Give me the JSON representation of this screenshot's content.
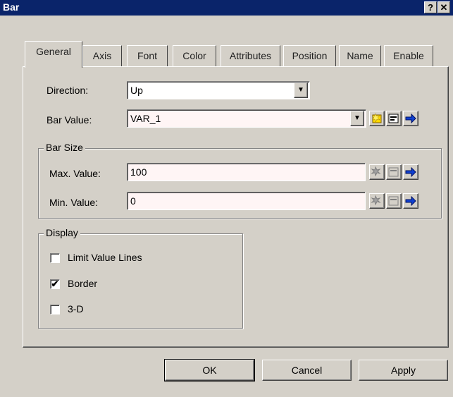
{
  "window": {
    "title": "Bar",
    "help": "?",
    "close": "✕"
  },
  "tabs": [
    "General",
    "Axis",
    "Font",
    "Color",
    "Attributes",
    "Position",
    "Name",
    "Enable"
  ],
  "general": {
    "direction_label": "Direction:",
    "direction_value": "Up",
    "bar_value_label": "Bar Value:",
    "bar_value": "VAR_1"
  },
  "bar_size": {
    "title": "Bar Size",
    "max_label": "Max. Value:",
    "max_value": "100",
    "min_label": "Min. Value:",
    "min_value": "0"
  },
  "display": {
    "title": "Display",
    "limit_value_lines": {
      "label": "Limit Value Lines",
      "checked": false
    },
    "border": {
      "label": "Border",
      "checked": true
    },
    "three_d": {
      "label": "3-D",
      "checked": false
    }
  },
  "buttons": {
    "ok": "OK",
    "cancel": "Cancel",
    "apply": "Apply"
  },
  "icons": {
    "ok_mark": "✔",
    "arrow": "➔"
  }
}
